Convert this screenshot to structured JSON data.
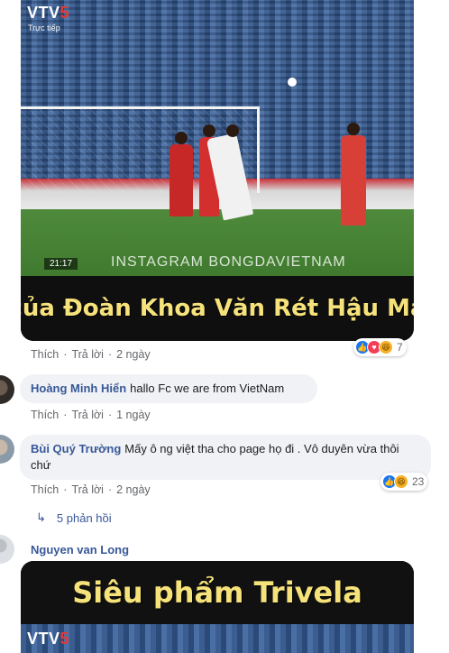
{
  "video1": {
    "channel_logo_text": "VTV",
    "channel_logo_number": "5",
    "live_label": "Trực tiếp",
    "clock": "21:17",
    "watermark": "INSTAGRAM BONGDAVIETNAM",
    "caption": "của Đoàn Khoa Văn Rét Hậu Ma"
  },
  "post_actions": {
    "like": "Thích",
    "reply": "Trả lời",
    "separator": "·",
    "time": "2 ngày",
    "reaction_count": "7",
    "reaction_icons": [
      "like-icon",
      "love-icon",
      "haha-icon"
    ]
  },
  "comments": [
    {
      "author": "Hoàng Minh Hiển",
      "text": "hallo Fc we are from VietNam",
      "like": "Thích",
      "reply": "Trả lời",
      "time": "1 ngày"
    },
    {
      "author": "Bùi Quý Trường",
      "text": "Mấy ô ng việt tha cho page họ đi . Vô duyên vừa thôi chứ",
      "like": "Thích",
      "reply": "Trả lời",
      "time": "2 ngày",
      "reaction_count": "23",
      "reaction_icons": [
        "like-icon",
        "haha-icon"
      ],
      "replies_label": "5 phản hồi"
    },
    {
      "author": "Nguyen van Long"
    }
  ],
  "video2": {
    "caption": "Siêu phẩm Trivela",
    "channel_logo_text": "VTV",
    "channel_logo_number": "5"
  },
  "colors": {
    "link_blue": "#385898",
    "meta_gray": "#65676b",
    "bubble_bg": "#f0f2f5",
    "caption_yellow": "#f6e27a",
    "like_blue": "#1877f2"
  }
}
